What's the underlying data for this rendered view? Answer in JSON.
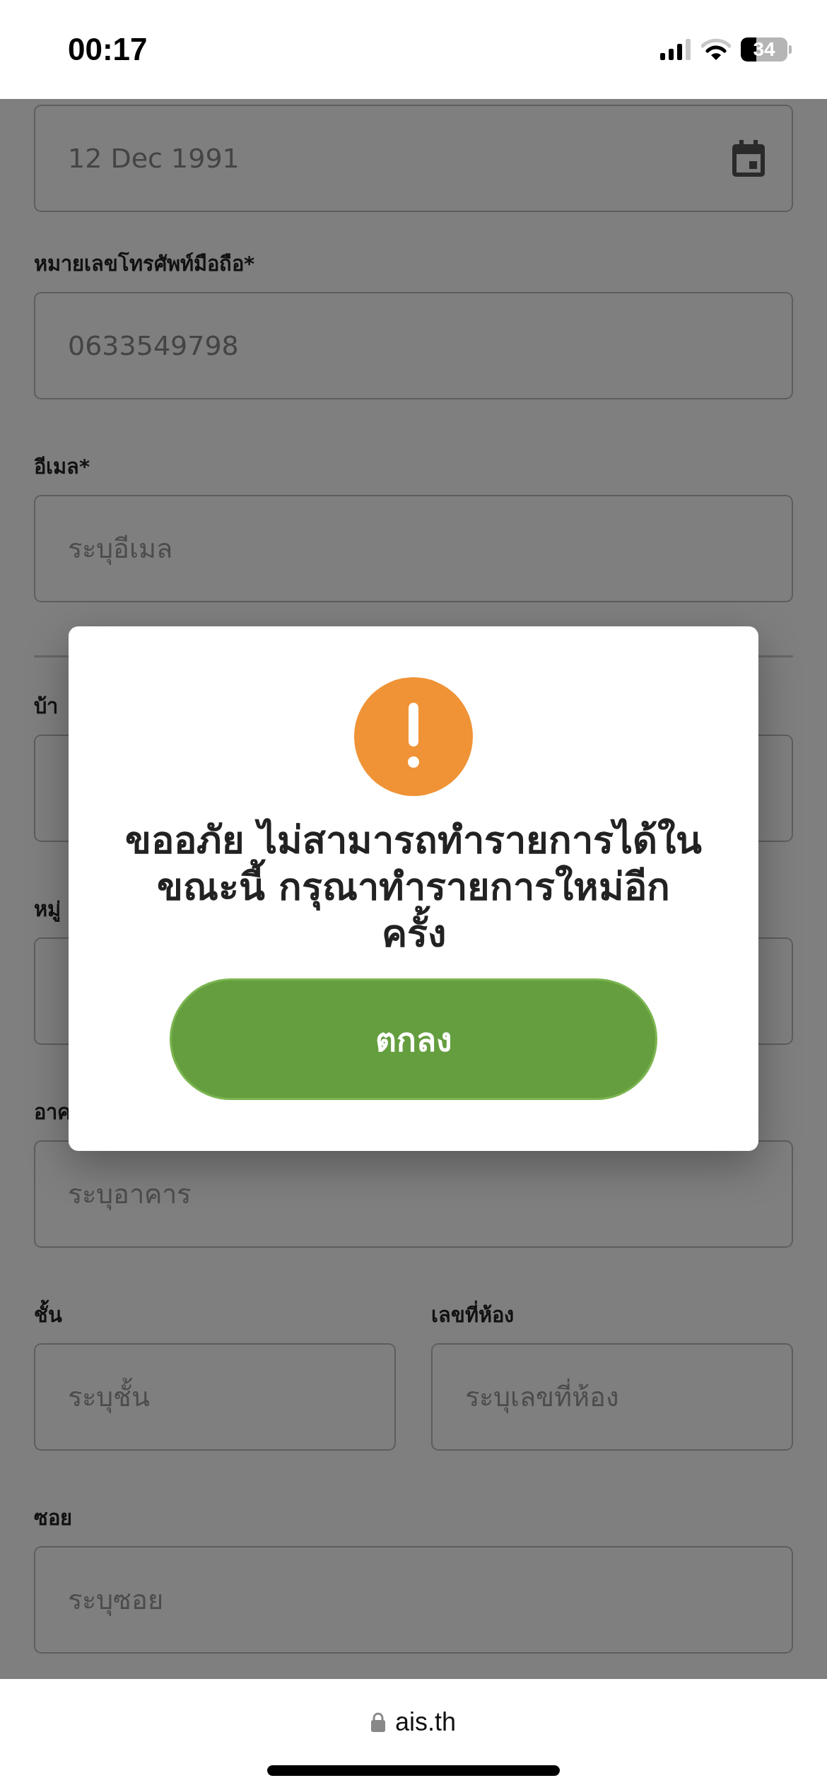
{
  "status_bar": {
    "time": "00:17",
    "battery": "34"
  },
  "form": {
    "sections": [
      {
        "rows": [
          [
            {
              "kind": "date",
              "value": "12 Dec 1991"
            }
          ],
          [
            {
              "kind": "text",
              "label": "หมายเลขโทรศัพท์มือถือ*",
              "value": "0633549798"
            }
          ],
          [
            {
              "kind": "text",
              "label": "อีเมล*",
              "placeholder": "ระบุอีเมล"
            }
          ]
        ]
      },
      {
        "rows": [
          [
            {
              "kind": "text",
              "label": "บ้า"
            }
          ],
          [
            {
              "kind": "text",
              "label": "หมู่"
            }
          ],
          [
            {
              "kind": "text",
              "label": "อาค",
              "placeholder": "ระบุอาคาร"
            }
          ],
          [
            {
              "kind": "text",
              "label": "ชั้น",
              "placeholder": "ระบุชั้น"
            },
            {
              "kind": "text",
              "label": "เลขที่ห้อง",
              "placeholder": "ระบุเลขที่ห้อง"
            }
          ],
          [
            {
              "kind": "text",
              "label": "ซอย",
              "placeholder": "ระบุซอย"
            }
          ]
        ]
      }
    ]
  },
  "dialog": {
    "message_lines": [
      "ขออภัย ไม่สามารถทำรายการได้ใน",
      "ขณะนี้ กรุณาทำรายการใหม่อีก",
      "ครั้ง"
    ],
    "button": "ตกลง"
  },
  "browser": {
    "url": "ais.th"
  }
}
